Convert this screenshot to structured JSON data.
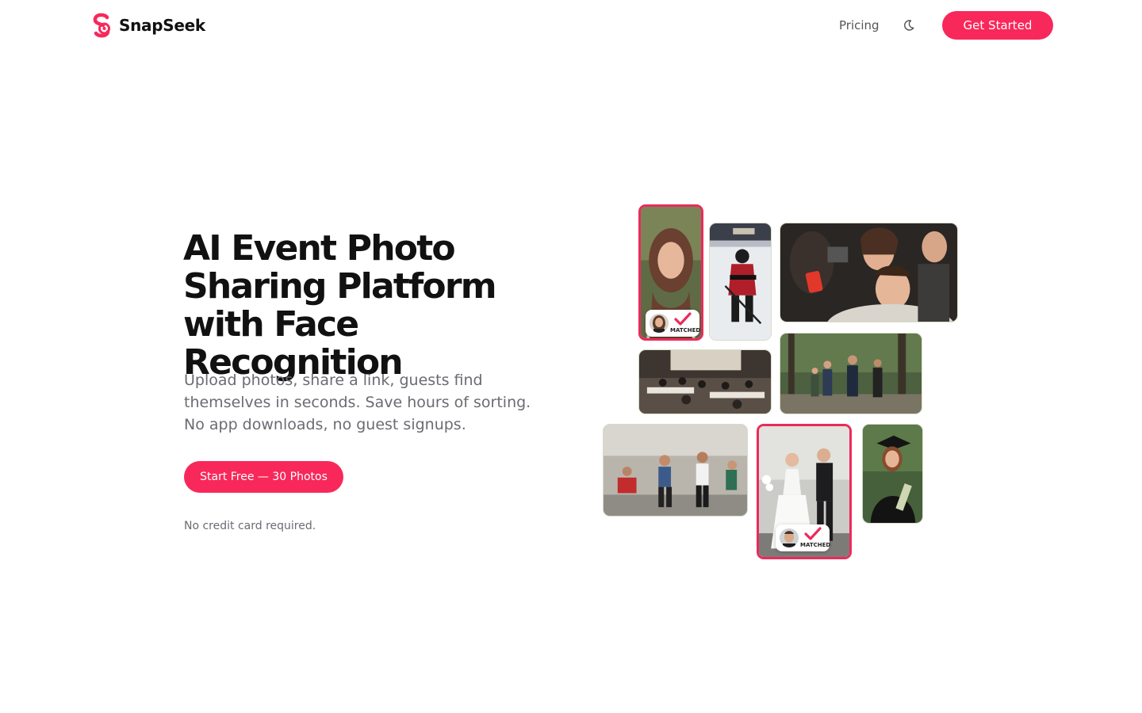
{
  "colors": {
    "brand": "#f8285a",
    "match_border": "#ec2a5b",
    "text_dark": "#111111",
    "text_muted": "#6b6b73"
  },
  "header": {
    "brand_name": "SnapSeek",
    "logo_icon": "snapseek-logo-icon",
    "nav_pricing": "Pricing",
    "theme_icon": "moon-icon",
    "cta_label": "Get Started"
  },
  "hero": {
    "title": "AI Event Photo Sharing Platform with Face Recognition",
    "subtitle": "Upload photos, share a link, guests find themselves in seconds. Save hours of sorting. No app downloads, no guest signups.",
    "cta_label": "Start Free — 30 Photos",
    "note": "No credit card required."
  },
  "gallery": {
    "photos": [
      {
        "subject": "smiling woman portrait",
        "matched": true
      },
      {
        "subject": "ice hockey player"
      },
      {
        "subject": "party crowd"
      },
      {
        "subject": "conference audience"
      },
      {
        "subject": "group walking in forest"
      },
      {
        "subject": "marathon runners"
      },
      {
        "subject": "wedding couple",
        "matched": true
      },
      {
        "subject": "graduate with diploma"
      }
    ],
    "badge_label": "MATCHED",
    "badge_icon": "checkmark-icon"
  }
}
